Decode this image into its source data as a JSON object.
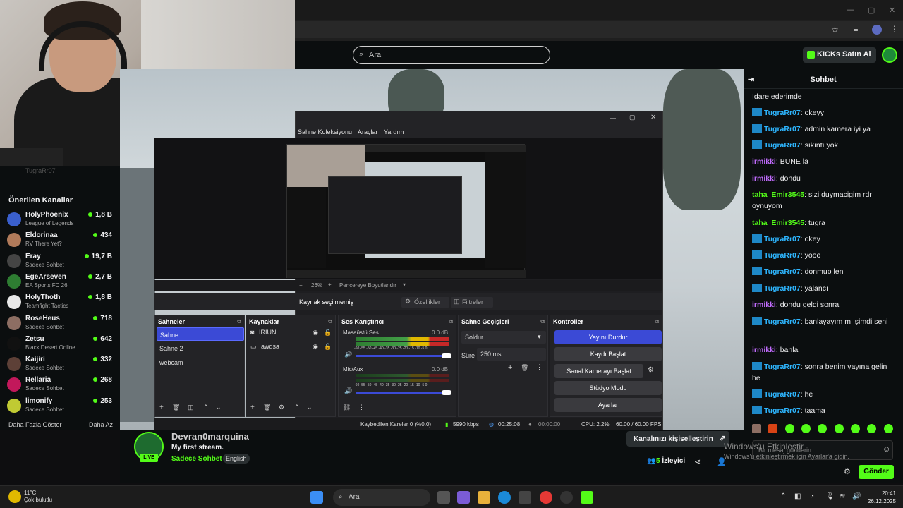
{
  "browser": {
    "search_placeholder": "Ara",
    "kicks_button": "KICKs Satın Al"
  },
  "sidebar": {
    "faded_channel": "TugraRr07",
    "title": "Önerilen Kanallar",
    "channels": [
      {
        "name": "HolyPhoenix",
        "game": "League of Legends",
        "viewers": "1,8 B",
        "color": "#3a5fcd"
      },
      {
        "name": "Eldorinaa",
        "game": "RV There Yet?",
        "viewers": "434",
        "color": "#b07a5a"
      },
      {
        "name": "Eray",
        "game": "Sadece Sohbet",
        "viewers": "19,7 B",
        "color": "#444444"
      },
      {
        "name": "EgeArseven",
        "game": "EA Sports FC 26",
        "viewers": "2,7 B",
        "color": "#2e7d32"
      },
      {
        "name": "HolyThoth",
        "game": "Teamfight Tactics",
        "viewers": "1,8 B",
        "color": "#e8e8e8"
      },
      {
        "name": "RoseHeus",
        "game": "Sadece Sohbet",
        "viewers": "718",
        "color": "#8d6e63"
      },
      {
        "name": "Zetsu",
        "game": "Black Desert Online",
        "viewers": "642",
        "color": "#111111"
      },
      {
        "name": "Kaijiri",
        "game": "Sadece Sohbet",
        "viewers": "332",
        "color": "#5d4037"
      },
      {
        "name": "Rellaria",
        "game": "Sadece Sohbet",
        "viewers": "268",
        "color": "#c2185b"
      },
      {
        "name": "limonify",
        "game": "Sadece Sohbet",
        "viewers": "253",
        "color": "#c0ca33"
      }
    ],
    "show_more": "Daha Fazla Göster",
    "show_less": "Daha Az"
  },
  "obs": {
    "menu": [
      "Sahne Koleksiyonu",
      "Araçlar",
      "Yardım"
    ],
    "zoom": "26%",
    "fit_label": "Pencereye Boyutlandır",
    "no_source": "Kaynak seçilmemiş",
    "properties": "Özellikler",
    "filters": "Filtreler",
    "scenes_title": "Sahneler",
    "scenes": [
      "Sahne",
      "Sahne 2",
      "webcam"
    ],
    "sources_title": "Kaynaklar",
    "sources": [
      "İRİUN",
      "awdsa"
    ],
    "mixer_title": "Ses Karıştırıcı",
    "mixer": [
      {
        "name": "Masaüstü Ses",
        "db": "0.0 dB"
      },
      {
        "name": "Mic/Aux",
        "db": "0.0 dB"
      }
    ],
    "meter_ticks": "-60 -55 -50 -45 -40 -35 -30 -25 -20 -15 -10 -5 0",
    "transitions_title": "Sahne Geçişleri",
    "transition": "Soldur",
    "duration_label": "Süre",
    "duration": "250 ms",
    "controls_title": "Kontroller",
    "controls": [
      "Yayını Durdur",
      "Kaydı Başlat",
      "Sanal Kamerayı Başlat",
      "Stüdyo Modu",
      "Ayarlar"
    ],
    "status": {
      "dropped": "Kaybedilen Kareler 0 (%0.0)",
      "bitrate": "5990 kbps",
      "live_time": "00:25:08",
      "rec_time": "00:00:00",
      "cpu": "CPU: 2.2%",
      "fps": "60.00 / 60.00 FPS"
    }
  },
  "stream": {
    "channel": "Devran0marquina",
    "title": "My first stream.",
    "category": "Sadece Sohbet",
    "language": "English",
    "live": "LIVE",
    "customize": "Kanalınızı kişiselleştirin",
    "viewer_count": "5",
    "viewer_label": "İzleyici"
  },
  "chat": {
    "title": "Sohbet",
    "messages": [
      {
        "user": "",
        "text": "İdare ederimde",
        "type": "none"
      },
      {
        "user": "TugraRr07",
        "text": "okeyy",
        "type": "tugra"
      },
      {
        "user": "TugraRr07",
        "text": "admin kamera iyi ya",
        "type": "tugra"
      },
      {
        "user": "TugraRr07",
        "text": "sıkıntı yok",
        "type": "tugra"
      },
      {
        "user": "irmikki",
        "text": "BUNE la",
        "type": "irm"
      },
      {
        "user": "irmikki",
        "text": "dondu",
        "type": "irm"
      },
      {
        "user": "taha_Emir3545",
        "text": "sizi duymacigim rdr oynuyom",
        "type": "taha"
      },
      {
        "user": "taha_Emir3545",
        "text": "tugra",
        "type": "taha"
      },
      {
        "user": "TugraRr07",
        "text": "okey",
        "type": "tugra"
      },
      {
        "user": "TugraRr07",
        "text": "yooo",
        "type": "tugra"
      },
      {
        "user": "TugraRr07",
        "text": "donmuo len",
        "type": "tugra"
      },
      {
        "user": "TugraRr07",
        "text": "yalancı",
        "type": "tugra"
      },
      {
        "user": "irmikki",
        "text": "dondu geldi sonra",
        "type": "irm"
      },
      {
        "user": "TugraRr07",
        "text": "banlayayım mı şimdi seni",
        "type": "tugra"
      },
      {
        "user": "irmikki",
        "text": "banla",
        "type": "irm"
      },
      {
        "user": "TugraRr07",
        "text": "sonra benim yayına gelin he",
        "type": "tugra"
      },
      {
        "user": "TugraRr07",
        "text": "he",
        "type": "tugra"
      },
      {
        "user": "TugraRr07",
        "text": "taama",
        "type": "tugra"
      }
    ],
    "input_placeholder": "Bir mesaj gönderin",
    "send": "Gönder"
  },
  "watermark": {
    "line1": "Windows'u Etkinleştir",
    "line2": "Windows'u etkinleştirmek için Ayarlar'a gidin."
  },
  "taskbar": {
    "temp": "11°C",
    "weather": "Çok bulutlu",
    "search": "Ara",
    "time": "20:41",
    "date": "26.12.2025"
  }
}
